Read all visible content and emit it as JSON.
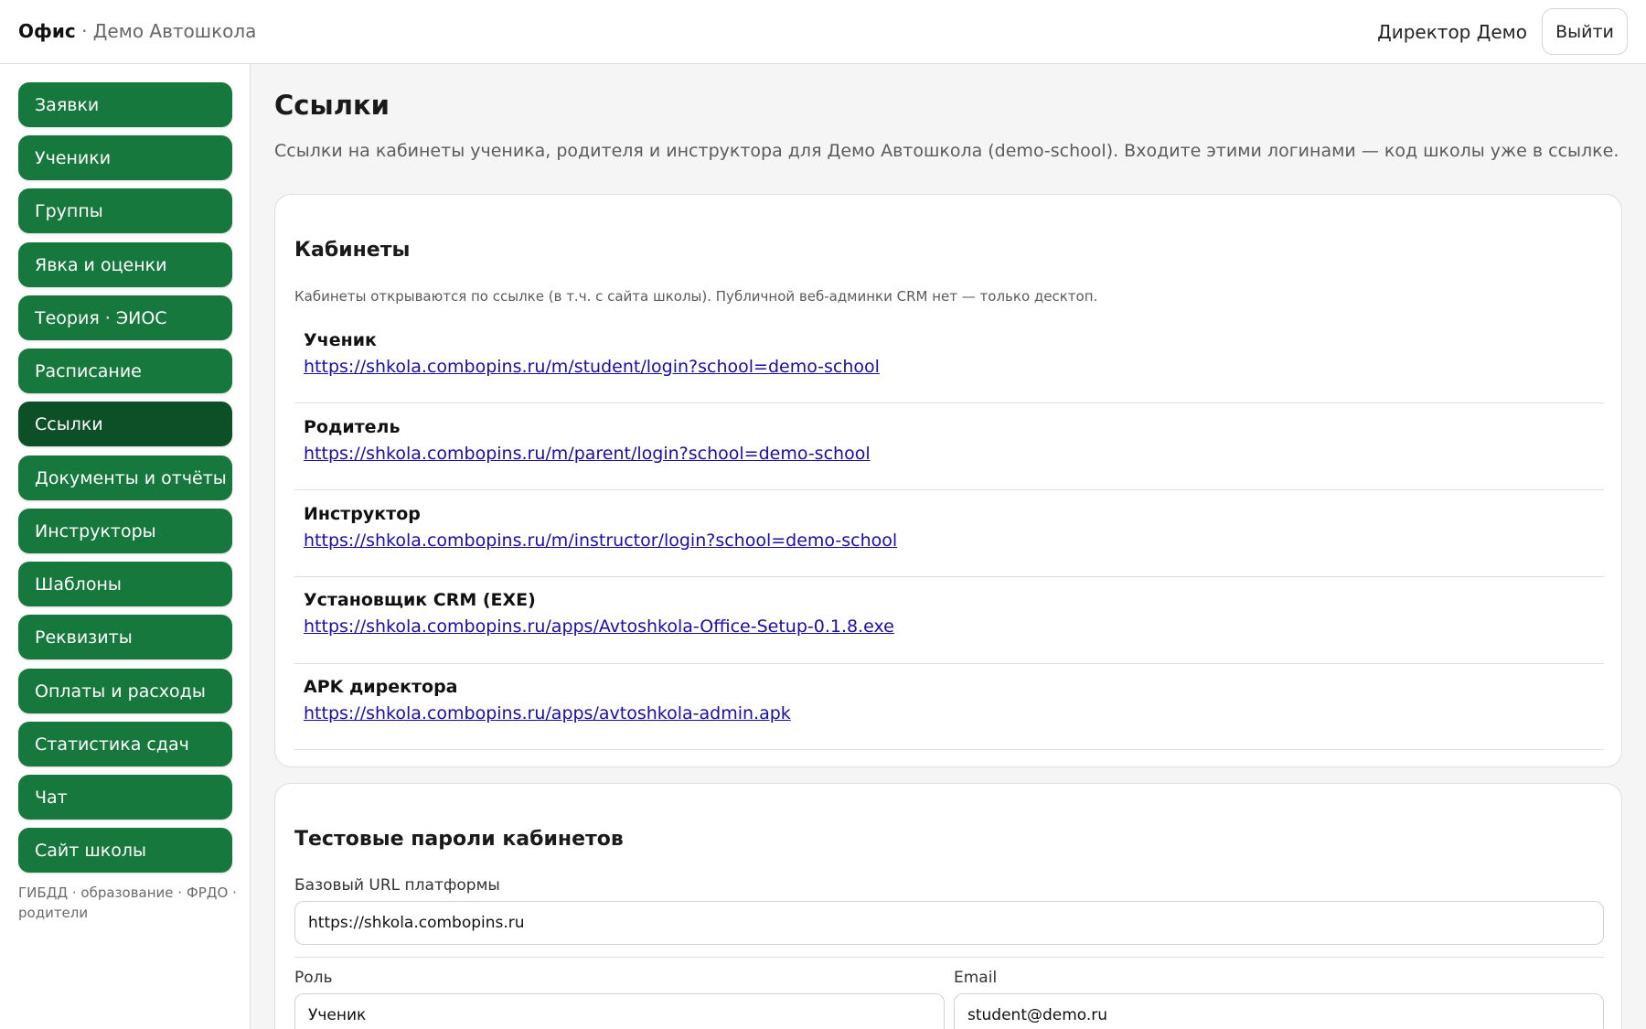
{
  "header": {
    "brand": "Офис",
    "separator": "·",
    "school": "Демо Автошкола",
    "user": "Директор Демо",
    "logout": "Выйти"
  },
  "sidebar": {
    "items": [
      {
        "label": "Заявки"
      },
      {
        "label": "Ученики"
      },
      {
        "label": "Группы"
      },
      {
        "label": "Явка и оценки"
      },
      {
        "label": "Теория · ЭИОС"
      },
      {
        "label": "Расписание"
      },
      {
        "label": "Ссылки",
        "active": true
      },
      {
        "label": "Документы и отчёты"
      },
      {
        "label": "Инструкторы"
      },
      {
        "label": "Шаблоны"
      },
      {
        "label": "Реквизиты"
      },
      {
        "label": "Оплаты и расходы"
      },
      {
        "label": "Статистика сдач"
      },
      {
        "label": "Чат"
      },
      {
        "label": "Сайт школы"
      }
    ],
    "footer": "ГИБДД · образование · ФРДО · родители"
  },
  "main": {
    "title": "Ссылки",
    "description": "Ссылки на кабинеты ученика, родителя и инструктора для Демо Автошкола (demo-school). Входите этими логинами — код школы уже в ссылке.",
    "cabinets": {
      "title": "Кабинеты",
      "note": "Кабинеты открываются по ссылке (в т.ч. с сайта школы). Публичной веб-админки CRM нет — только десктоп.",
      "links": [
        {
          "label": "Ученик",
          "url": "https://shkola.combopins.ru/m/student/login?school=demo-school"
        },
        {
          "label": "Родитель",
          "url": "https://shkola.combopins.ru/m/parent/login?school=demo-school"
        },
        {
          "label": "Инструктор",
          "url": "https://shkola.combopins.ru/m/instructor/login?school=demo-school"
        },
        {
          "label": "Установщик CRM (EXE)",
          "url": "https://shkola.combopins.ru/apps/Avtoshkola-Office-Setup-0.1.8.exe"
        },
        {
          "label": "APK директора",
          "url": "https://shkola.combopins.ru/apps/avtoshkola-admin.apk"
        }
      ]
    },
    "passwords": {
      "title": "Тестовые пароли кабинетов",
      "base_url_label": "Базовый URL платформы",
      "base_url_value": "https://shkola.combopins.ru",
      "role_label": "Роль",
      "role_value": "Ученик",
      "email_label": "Email",
      "email_value": "student@demo.ru"
    }
  },
  "colors": {
    "nav_bg": "#17783d",
    "nav_active": "#0d4f26",
    "link": "#1a0dab"
  }
}
